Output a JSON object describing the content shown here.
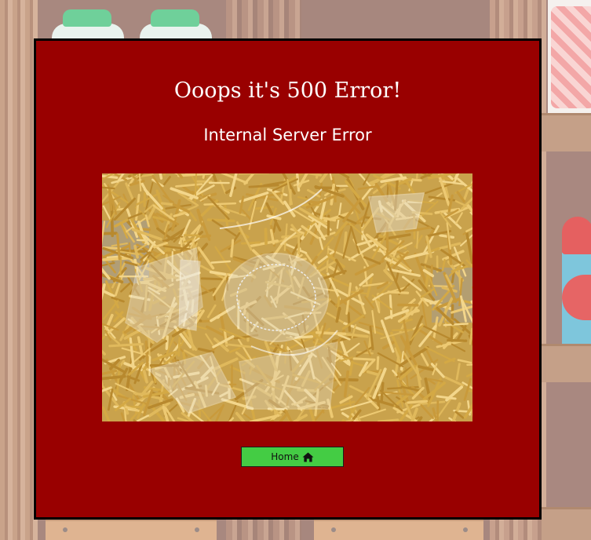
{
  "page": {
    "title": "Ooops it's 500 Error!",
    "subtitle": "Internal Server Error",
    "home_button_label": "Home",
    "home_icon": "home-icon",
    "image_subject": "broken-glass-bowl-on-noodles"
  },
  "colors": {
    "panel_background": "#990000",
    "panel_border": "#000000",
    "text": "#ffffff",
    "home_button": "#44cc44"
  }
}
